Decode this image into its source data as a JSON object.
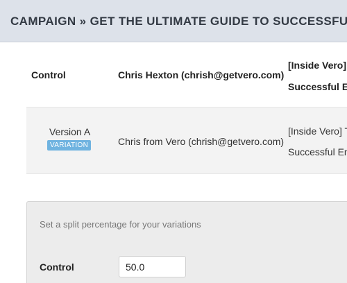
{
  "header": {
    "title": "CAMPAIGN » GET THE ULTIMATE GUIDE TO SUCCESSFUL EMAIL"
  },
  "table": {
    "header_row": {
      "name": "Control",
      "from": "Chris Hexton (chrish@getvero.com)",
      "subject_line1": "[Inside Vero] T",
      "subject_line2": "Successful Em"
    },
    "variation_row": {
      "name": "Version A",
      "badge": "VARIATION",
      "from": "Chris from Vero (chrish@getvero.com)",
      "subject_line1": "[Inside Vero] T",
      "subject_line2": "Successful Em"
    }
  },
  "split_panel": {
    "hint": "Set a split percentage for your variations",
    "label": "Control",
    "value": "50.0"
  },
  "colors": {
    "header_bg": "#dde2ea",
    "badge_bg": "#6fb3e0",
    "row_bg": "#f3f3f3",
    "panel_bg": "#ececec"
  }
}
